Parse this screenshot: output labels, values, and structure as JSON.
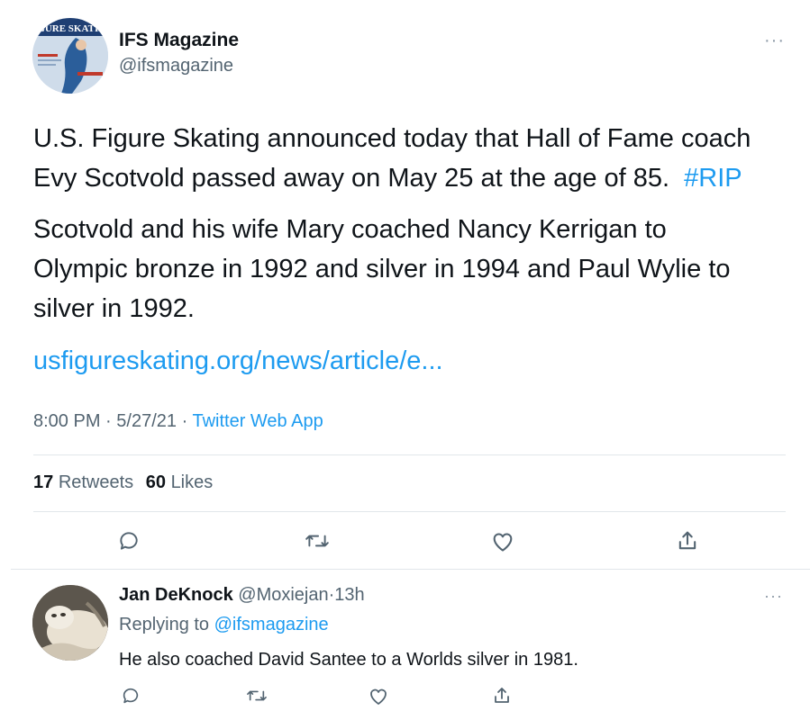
{
  "tweet": {
    "author_name": "IFS Magazine",
    "author_handle": "@ifsmagazine",
    "avatar_text": "FIGURE SKATING",
    "more_label": "···",
    "line1": "U.S. Figure Skating announced today that Hall of Fame coach",
    "line2": "Evy Scotvold passed away on May 25 at the age of 85.",
    "hashtag": "#RIP",
    "para2_line1": "Scotvold and his wife Mary coached Nancy Kerrigan to",
    "para2_line2": "Olympic bronze in 1992 and silver in 1994 and Paul Wylie to",
    "para2_line3": "silver in 1992.",
    "link": "usfigureskating.org/news/article/e...",
    "time": "8:00 PM",
    "date": "5/27/21",
    "source": "Twitter Web App",
    "sep": "·",
    "retweet_count": "17",
    "retweet_label": "Retweets",
    "like_count": "60",
    "like_label": "Likes"
  },
  "actions": {
    "reply_icon": "reply-icon",
    "retweet_icon": "retweet-icon",
    "like_icon": "heart-icon",
    "share_icon": "share-icon"
  },
  "reply": {
    "author_name": "Jan DeKnock",
    "author_handle": "@Moxiejan",
    "sep": "·",
    "time": "13h",
    "replying_label": "Replying to",
    "replying_handle": "@ifsmagazine",
    "text": "He also coached David Santee to a Worlds silver in 1981.",
    "more_label": "···"
  },
  "colors": {
    "link": "#1d9bf0",
    "muted": "#536471",
    "text": "#0f1419"
  }
}
